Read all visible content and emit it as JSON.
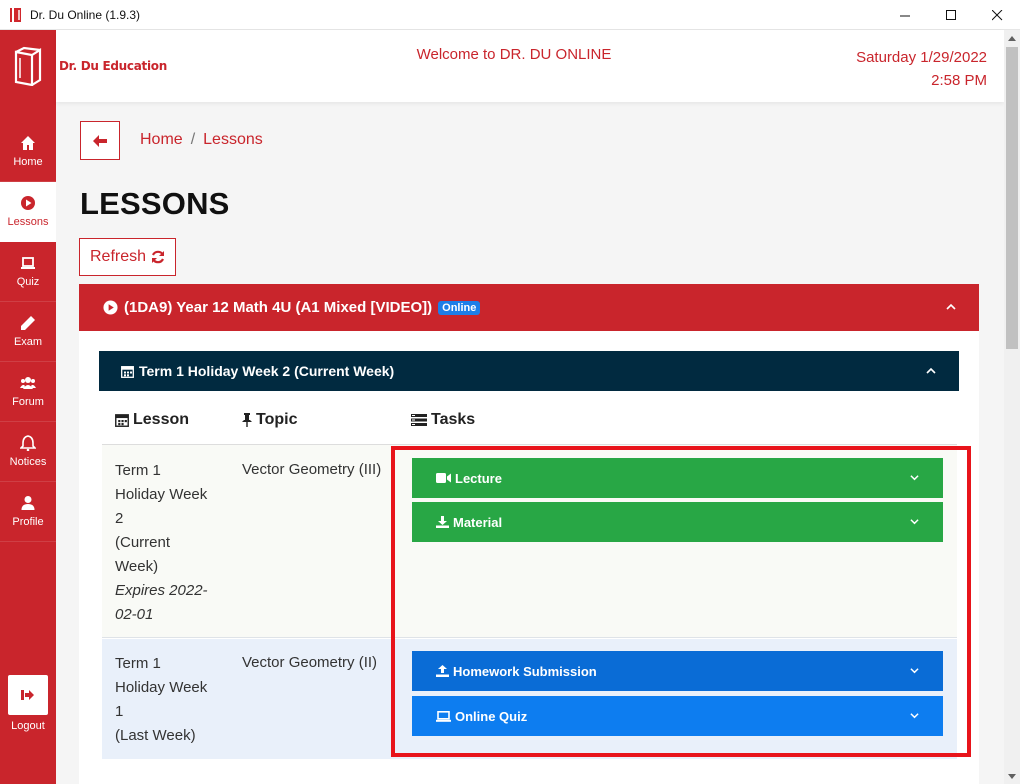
{
  "window": {
    "title": "Dr. Du Online (1.9.3)"
  },
  "brand": {
    "name": "Dr. Du Education"
  },
  "header": {
    "welcome": "Welcome to DR. DU ONLINE",
    "date": "Saturday 1/29/2022",
    "time": "2:58 PM"
  },
  "sidebar": {
    "items": [
      {
        "label": "Home"
      },
      {
        "label": "Lessons"
      },
      {
        "label": "Quiz"
      },
      {
        "label": "Exam"
      },
      {
        "label": "Forum"
      },
      {
        "label": "Notices"
      },
      {
        "label": "Profile"
      }
    ],
    "logout": "Logout"
  },
  "breadcrumb": {
    "home": "Home",
    "separator": "/",
    "current": "Lessons"
  },
  "page": {
    "title": "LESSONS",
    "refresh_label": "Refresh"
  },
  "course": {
    "title": "(1DA9) Year 12 Math 4U (A1 Mixed [VIDEO])",
    "badge": "Online"
  },
  "week": {
    "title": "Term 1 Holiday Week 2 (Current Week)"
  },
  "table": {
    "headers": {
      "lesson": "Lesson",
      "topic": "Topic",
      "tasks": "Tasks"
    },
    "rows": [
      {
        "lesson_lines": [
          "Term 1",
          "Holiday Week",
          "2",
          "(Current",
          "Week)"
        ],
        "expires": [
          "Expires 2022-",
          "02-01"
        ],
        "topic": "Vector Geometry (III)",
        "tasks": [
          "Lecture",
          "Material"
        ]
      },
      {
        "lesson_lines": [
          "Term 1",
          "Holiday Week",
          "1",
          "(Last Week)"
        ],
        "topic": "Vector Geometry (II)",
        "tasks": [
          "Homework Submission",
          "Online Quiz"
        ]
      }
    ]
  },
  "colors": {
    "accent": "#c9252c",
    "navy": "#012a40",
    "green": "#28a745",
    "blue": "#0d7df0",
    "highlight": "#e8141b"
  }
}
